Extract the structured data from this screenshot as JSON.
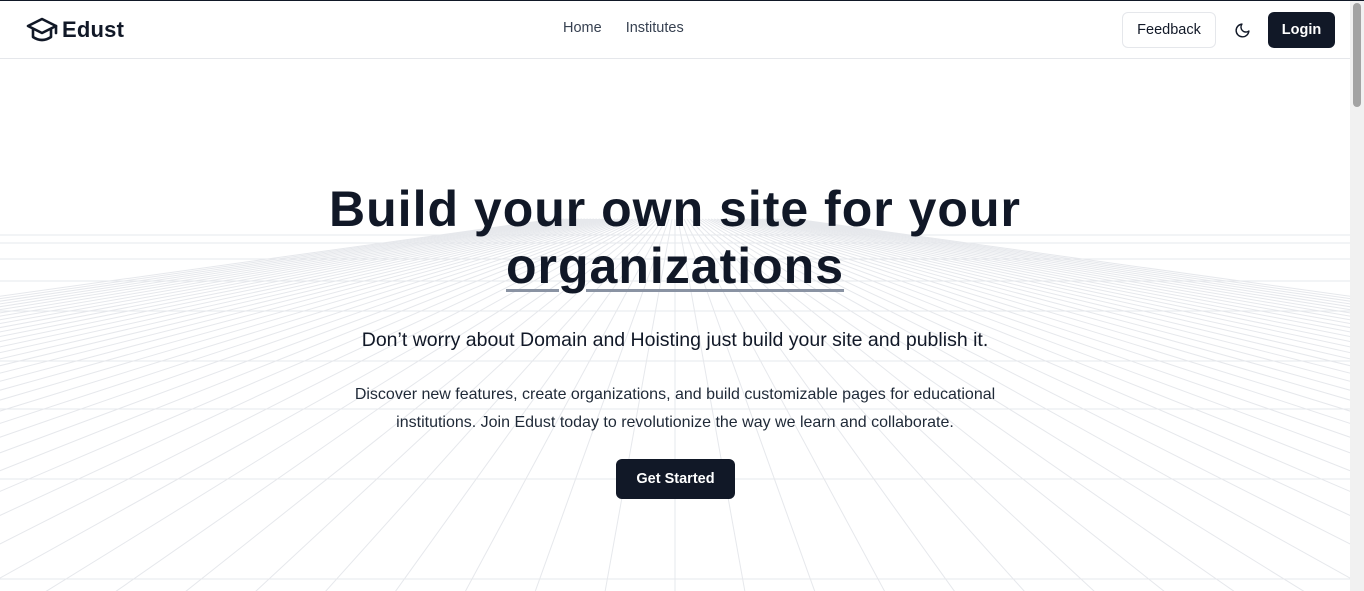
{
  "navbar": {
    "brand_name": "Edust",
    "brand_icon": "graduation-cap-icon",
    "links": [
      {
        "label": "Home"
      },
      {
        "label": "Institutes"
      }
    ],
    "feedback_label": "Feedback",
    "theme_icon": "moon-icon",
    "login_label": "Login"
  },
  "hero": {
    "title_line1": "Build your own site for your",
    "title_line2": "organizations",
    "subtitle": "Don’t worry about Domain and Hoisting just build your site and publish it.",
    "description": "Discover new features, create organizations, and build customizable pages for educational institutions. Join Edust today to revolutionize the way we learn and collaborate.",
    "cta_label": "Get Started"
  },
  "colors": {
    "primary": "#111827",
    "border": "#e5e7eb",
    "underline": "#8a93a3",
    "grid_line": "#e9ebef"
  }
}
